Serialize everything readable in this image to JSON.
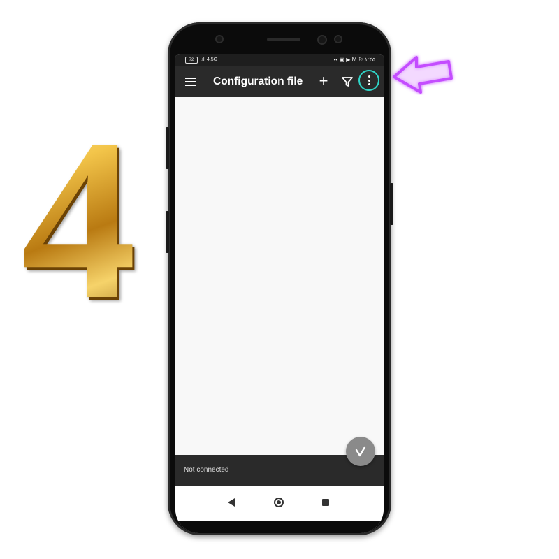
{
  "step": {
    "number": "4"
  },
  "statusbar": {
    "battery": "72",
    "signal": ".ıll 4.5G",
    "network": "4G",
    "indicators": "•• ▣ ▶ M ⚐ ",
    "time": "۱:۴۵"
  },
  "appbar": {
    "title": "Configuration file",
    "menu_icon": "hamburger-menu-icon",
    "add_icon": "plus-icon",
    "filter_icon": "filter-icon",
    "more_icon": "more-vertical-icon"
  },
  "status": {
    "text": "Not connected"
  },
  "fab": {
    "icon": "v-connect-icon"
  },
  "highlight": {
    "ring_color": "#2fd5c8",
    "arrow_color": "#c44dff"
  }
}
